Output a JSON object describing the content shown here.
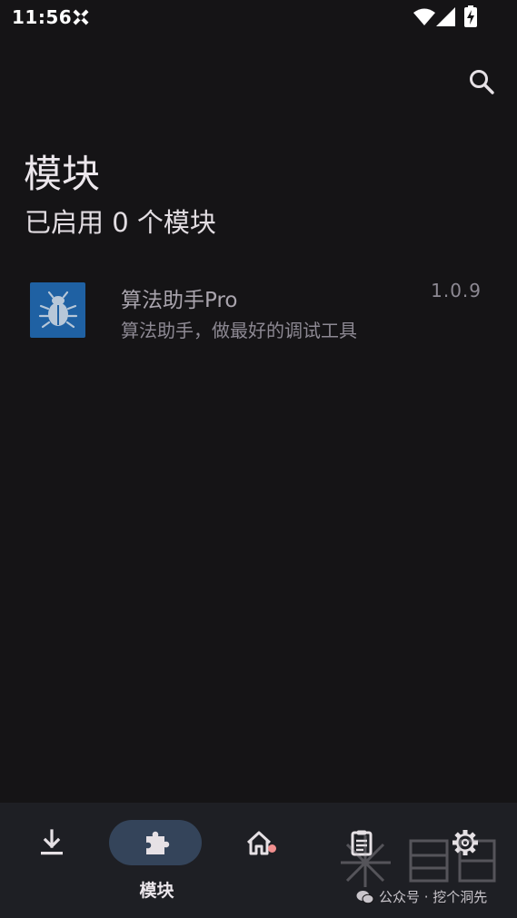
{
  "status_bar": {
    "time": "11:56"
  },
  "header": {
    "title": "模块",
    "subtitle": "已启用 0 个模块"
  },
  "modules": [
    {
      "name": "算法助手Pro",
      "description": "算法助手，做最好的调试工具",
      "version": "1.0.9",
      "icon": "bug-icon",
      "icon_color": "#1f61a3"
    }
  ],
  "nav": {
    "items": [
      {
        "id": "download",
        "icon": "download-icon",
        "label": ""
      },
      {
        "id": "modules",
        "icon": "puzzle-icon",
        "label": "模块",
        "selected": true
      },
      {
        "id": "home",
        "icon": "home-icon",
        "label": "",
        "badge": true
      },
      {
        "id": "logs",
        "icon": "clipboard-icon",
        "label": ""
      },
      {
        "id": "settings",
        "icon": "gear-icon",
        "label": ""
      }
    ]
  },
  "watermark": {
    "text": "公众号 · 挖个洞先"
  },
  "colors": {
    "background": "#151416",
    "nav_background": "#1e1f24",
    "nav_pill": "#34445a",
    "badge": "#f18f8f"
  }
}
